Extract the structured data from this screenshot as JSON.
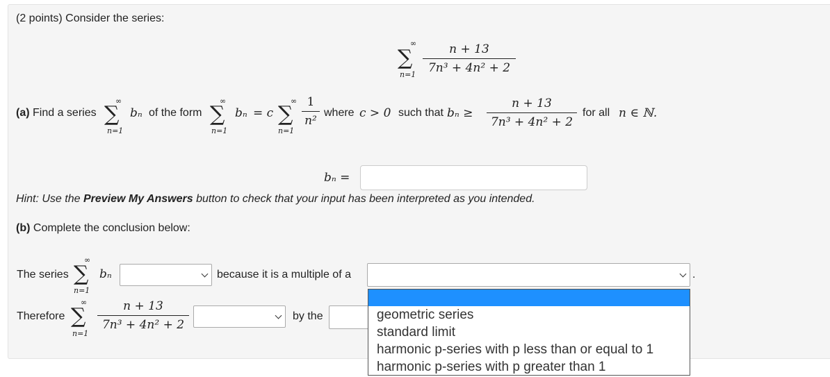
{
  "problem": {
    "points": "(2 points)",
    "intro": "Consider the series:",
    "series_lower": "n=1",
    "series_upper": "∞",
    "series_num": "n + 13",
    "series_den": "7n³ + 4n² + 2"
  },
  "part_a": {
    "label": "(a)",
    "text1": "Find a series",
    "bn": "bₙ",
    "text2": "of the form",
    "equals_c": "= c",
    "one_over_num": "1",
    "one_over_den": "n²",
    "text3": "where",
    "cond_c": "c > 0",
    "text4": "such that",
    "ge": "bₙ ≥",
    "text5": "for all",
    "n_in_N": "n ∈ ℕ.",
    "answer_label": "bₙ =",
    "answer_value": ""
  },
  "hint": {
    "prefix": "Hint: Use the ",
    "button_name": "Preview My Answers",
    "suffix": " button to check that your input has been interpreted as you intended."
  },
  "part_b": {
    "label": "(b)",
    "text": "Complete the conclusion below:",
    "row1_prefix": "The series",
    "row1_middle": "because it is a multiple of a",
    "row1_end": ".",
    "row2_prefix": "Therefore",
    "row2_middle": "by the",
    "select1_value": "",
    "select2_value": "",
    "select3_value": "",
    "input_value": ""
  },
  "dropdown": {
    "options": [
      "",
      "geometric series",
      "standard limit",
      "harmonic p-series with p less than or equal to 1",
      "harmonic p-series with p greater than 1"
    ]
  },
  "colors": {
    "highlight": "#1e90ff",
    "panel": "#f5f5f5"
  }
}
